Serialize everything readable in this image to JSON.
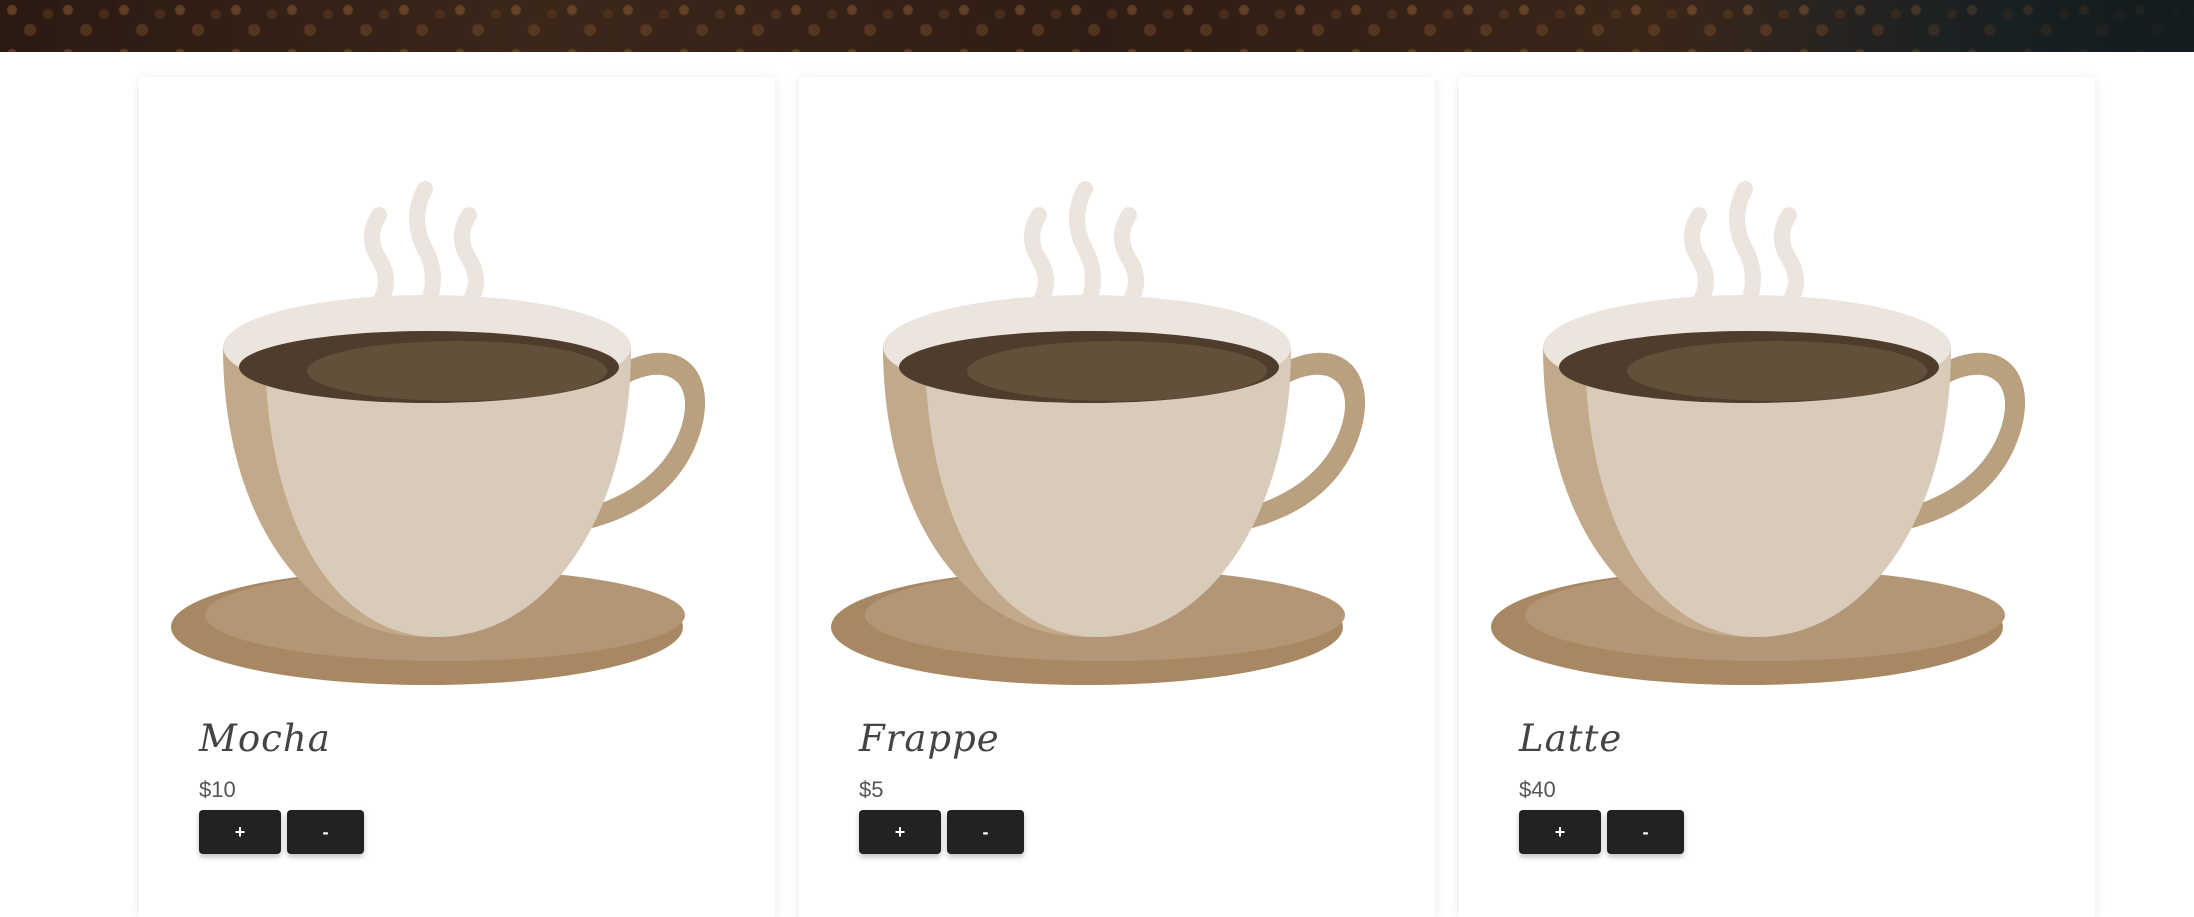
{
  "products": [
    {
      "name": "Mocha",
      "price": "$10",
      "add_label": "+",
      "remove_label": "-"
    },
    {
      "name": "Frappe",
      "price": "$5",
      "add_label": "+",
      "remove_label": "-"
    },
    {
      "name": "Latte",
      "price": "$40",
      "add_label": "+",
      "remove_label": "-"
    }
  ],
  "icons": {
    "product_image": "coffee-cup-illustration"
  },
  "colors": {
    "button_bg": "#222222",
    "button_text": "#ffffff",
    "cup_body": "#d9cbb9",
    "cup_shadow": "#c2a98a",
    "coffee": "#62503a",
    "saucer": "#b09373",
    "steam": "#ece5de"
  }
}
